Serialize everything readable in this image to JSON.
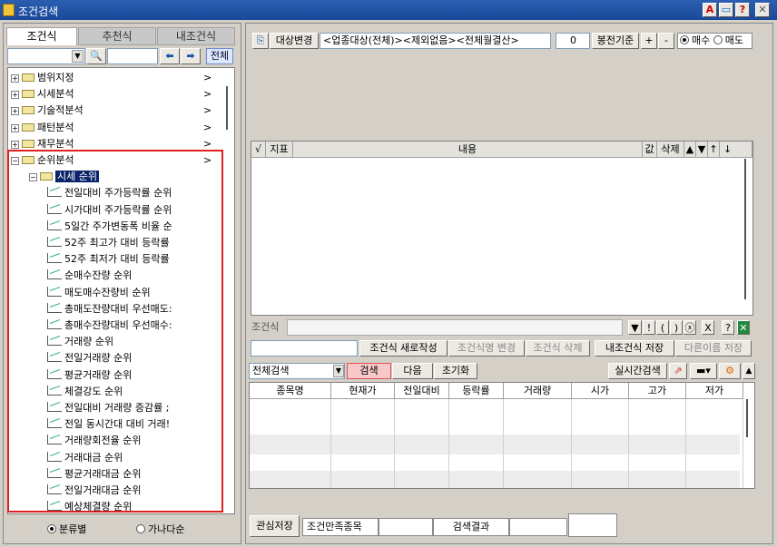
{
  "window": {
    "title": "조건검색"
  },
  "title_buttons": [
    "A",
    "▭",
    "?",
    "✕"
  ],
  "left": {
    "tabs": [
      "조건식",
      "추천식",
      "내조건식"
    ],
    "search_value": "",
    "all_button": "전체",
    "tree": [
      {
        "label": "범위지정",
        "level": 0,
        "expand": "+",
        "arrow": ">"
      },
      {
        "label": "시세분석",
        "level": 0,
        "expand": "+",
        "arrow": ">"
      },
      {
        "label": "기술적분석",
        "level": 0,
        "expand": "+",
        "arrow": ">"
      },
      {
        "label": "패턴분석",
        "level": 0,
        "expand": "+",
        "arrow": ">"
      },
      {
        "label": "재무분석",
        "level": 0,
        "expand": "+",
        "arrow": ">"
      },
      {
        "label": "순위분석",
        "level": 0,
        "expand": "−",
        "arrow": ">"
      },
      {
        "label": "시세 순위",
        "level": 1,
        "expand": "−",
        "arrow": "",
        "selected": true
      },
      {
        "label": "전일대비 주가등락률 순위",
        "level": 2
      },
      {
        "label": "시가대비 주가등락률 순위",
        "level": 2
      },
      {
        "label": "5일간 주가변동폭 비율 순",
        "level": 2
      },
      {
        "label": "52주 최고가 대비 등락률",
        "level": 2
      },
      {
        "label": "52주 최저가 대비 등락률",
        "level": 2
      },
      {
        "label": "순매수잔량 순위",
        "level": 2
      },
      {
        "label": "매도매수잔량비 순위",
        "level": 2
      },
      {
        "label": "총매도잔량대비 우선매도:",
        "level": 2
      },
      {
        "label": "총매수잔량대비 우선매수:",
        "level": 2
      },
      {
        "label": "거래량 순위",
        "level": 2
      },
      {
        "label": "전일거래량 순위",
        "level": 2
      },
      {
        "label": "평균거래량 순위",
        "level": 2
      },
      {
        "label": "체결강도 순위",
        "level": 2
      },
      {
        "label": "전일대비 거래량 증감률 ;",
        "level": 2
      },
      {
        "label": "전일 동시간대 대비 거래!",
        "level": 2
      },
      {
        "label": "거래량회전율 순위",
        "level": 2
      },
      {
        "label": "거래대금 순위",
        "level": 2
      },
      {
        "label": "평균거래대금 순위",
        "level": 2
      },
      {
        "label": "전일거래대금 순위",
        "level": 2
      },
      {
        "label": "예상체결량 순위",
        "level": 2
      }
    ],
    "radio": [
      {
        "label": "분류별",
        "checked": true
      },
      {
        "label": "가나다순",
        "checked": false
      }
    ]
  },
  "right": {
    "target_button": "대상변경",
    "target_text": "<업종대상(전체)><제외없음><전체월결산>",
    "bong_value": "0",
    "bong_label": "봉전기준",
    "plus": "+",
    "minus": "-",
    "buy_sell": [
      {
        "label": "매수",
        "checked": true
      },
      {
        "label": "매도",
        "checked": false
      }
    ],
    "condition_headers": [
      "√",
      "지표",
      "내용",
      "값",
      "삭제",
      "▲",
      "▼",
      "↑",
      "↓"
    ],
    "formula_label": "조건식",
    "formula_value": "",
    "formula_ops": [
      "▼",
      "!",
      "(",
      ")",
      "ⓧ",
      "X",
      "?"
    ],
    "name_value": "",
    "buttons_row": [
      "조건식 새로작성",
      "조건식명 변경",
      "조건식 삭제",
      "내조건식 저장",
      "다른이름 저장"
    ],
    "search_scope": "전체검색",
    "search_btn": "검색",
    "next_btn": "다음",
    "reset_btn": "초기화",
    "realtime_btn": "실시간검색",
    "result_headers": [
      "종목명",
      "현재가",
      "전일대비",
      "등락률",
      "거래량",
      "시가",
      "고가",
      "저가"
    ],
    "interest_save": "관심저장",
    "footer_label": "조건만족종목",
    "footer_value": "",
    "footer_label2": "검색결과",
    "footer_value2": ""
  },
  "colors": {
    "title_bg": "#1a4899",
    "highlight_border": "#e02020",
    "selected_bg": "#0a246a",
    "search_btn_bg": "#f8c8c8"
  }
}
